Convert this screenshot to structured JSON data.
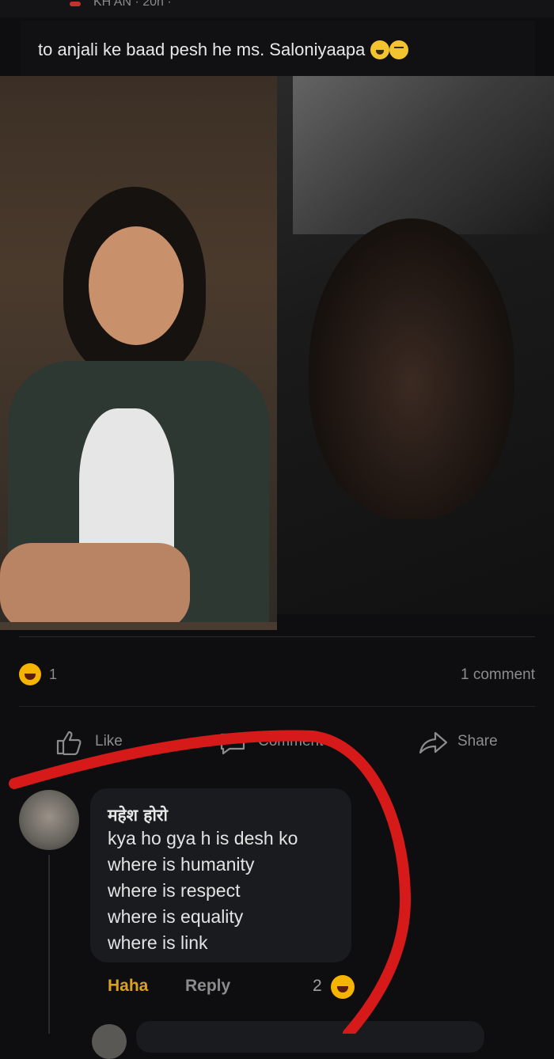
{
  "post": {
    "author_partial": "KH AN · 20h ·",
    "caption": "to anjali ke baad pesh he ms. Saloniyaapa",
    "caption_emojis": [
      "grimacing-face",
      "crying-laughing-face"
    ]
  },
  "stats": {
    "reaction_count": "1",
    "comment_count": "1 comment"
  },
  "actions": {
    "like": "Like",
    "comment": "Comment",
    "share": "Share"
  },
  "comment": {
    "author": "महेश होरो",
    "lines": [
      "kya ho gya h is desh ko",
      "where is humanity",
      "where is respect",
      "where is equality",
      "where is link"
    ],
    "haha_label": "Haha",
    "reply_label": "Reply",
    "reaction_count": "2"
  },
  "colors": {
    "background": "#0e0e10",
    "haha_accent": "#d9a21e",
    "annotation_red": "#d61a1a"
  }
}
